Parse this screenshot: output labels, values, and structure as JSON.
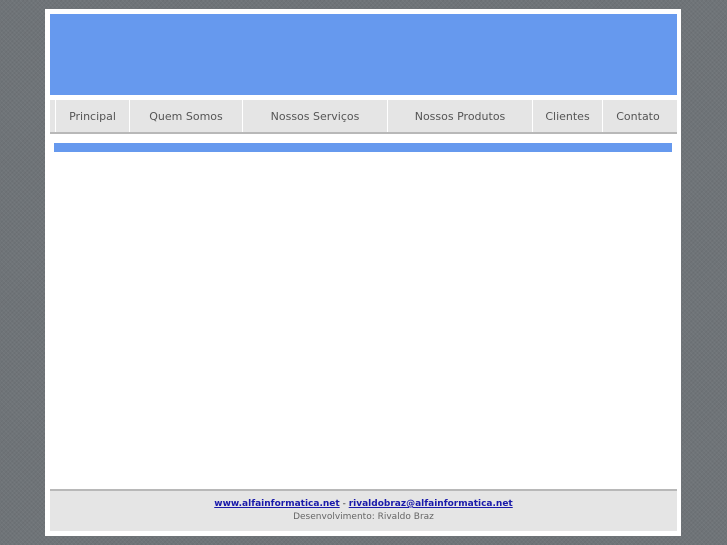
{
  "nav": {
    "items": [
      {
        "label": "Principal"
      },
      {
        "label": "Quem Somos"
      },
      {
        "label": "Nossos Serviços"
      },
      {
        "label": "Nossos Produtos"
      },
      {
        "label": "Clientes"
      },
      {
        "label": "Contato"
      }
    ]
  },
  "footer": {
    "site_link": "www.alfainformatica.net",
    "separator": "-",
    "email_link": "rivaldobraz@alfainformatica.net",
    "credit": "Desenvolvimento: Rivaldo Braz"
  },
  "colors": {
    "banner": "#6699ee",
    "nav_bg": "#e5e5e5",
    "page_bg": "#ffffff",
    "outer_bg": "#6f7478"
  }
}
